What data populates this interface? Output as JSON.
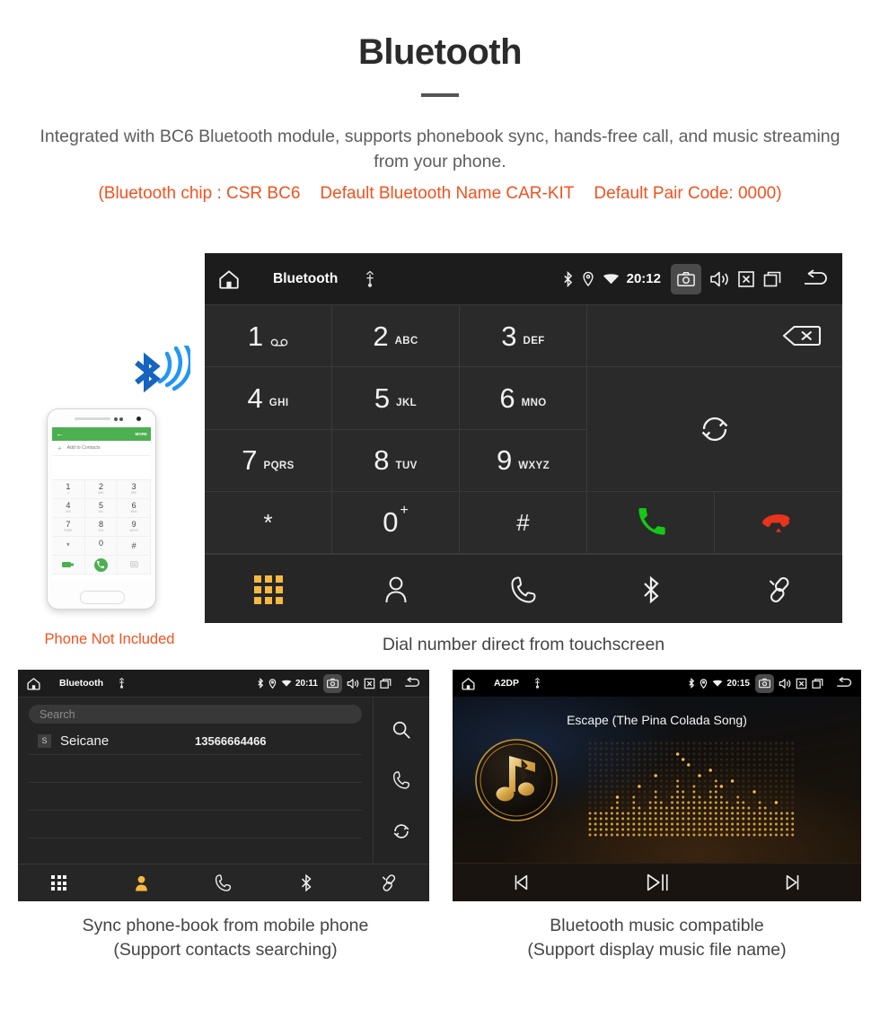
{
  "header": {
    "title": "Bluetooth",
    "description": "Integrated with BC6 Bluetooth module, supports phonebook sync, hands-free call, and music streaming from your phone.",
    "specs": [
      "(Bluetooth chip : CSR BC6",
      "Default Bluetooth Name CAR-KIT",
      "Default Pair Code: 0000)"
    ],
    "accent_color": "#f4511e",
    "body_color": "#5d5d5d"
  },
  "dialer": {
    "status_bar": {
      "home_icon": "home-icon",
      "title": "Bluetooth",
      "usb_icon": "usb-icon",
      "bluetooth_icon": "bluetooth-icon",
      "location_icon": "location-pin-icon",
      "wifi_icon": "wifi-icon",
      "clock": "20:12",
      "camera_icon": "camera-icon",
      "volume_icon": "speaker-icon",
      "close_icon": "close-box-icon",
      "recents_icon": "recent-apps-icon",
      "back_icon": "back-arrow-icon"
    },
    "keys": [
      {
        "digit": "1",
        "letters": "",
        "voicemail": true
      },
      {
        "digit": "2",
        "letters": "ABC"
      },
      {
        "digit": "3",
        "letters": "DEF"
      },
      {
        "digit": "4",
        "letters": "GHI"
      },
      {
        "digit": "5",
        "letters": "JKL"
      },
      {
        "digit": "6",
        "letters": "MNO"
      },
      {
        "digit": "7",
        "letters": "PQRS"
      },
      {
        "digit": "8",
        "letters": "TUV"
      },
      {
        "digit": "9",
        "letters": "WXYZ"
      },
      {
        "digit": "*",
        "letters": ""
      },
      {
        "digit": "0",
        "letters": "",
        "plus": "+"
      },
      {
        "digit": "#",
        "letters": ""
      }
    ],
    "backspace_icon": "backspace-icon",
    "sync_icon": "sync-icon",
    "call_icon": "call-icon",
    "call_color": "#17c617",
    "hangup_icon": "hangup-icon",
    "hangup_color": "#e8341c",
    "nav": [
      {
        "name": "keypad",
        "icon": "keypad-grid-icon",
        "active": true
      },
      {
        "name": "contacts",
        "icon": "person-icon",
        "active": false
      },
      {
        "name": "call-log",
        "icon": "handset-icon",
        "active": false
      },
      {
        "name": "bluetooth",
        "icon": "bluetooth-icon",
        "active": false
      },
      {
        "name": "pair-link",
        "icon": "link-icon",
        "active": false
      }
    ],
    "active_color": "#f5b942",
    "caption": "Dial number direct from touchscreen"
  },
  "phone_illustration": {
    "bluetooth_signal_icon": "bluetooth-signal-icon",
    "app_more_label": "MORE",
    "add_contacts_label": "Add to Contacts",
    "keys": [
      {
        "digit": "1",
        "letters": "∞"
      },
      {
        "digit": "2",
        "letters": "ABC"
      },
      {
        "digit": "3",
        "letters": "DEF"
      },
      {
        "digit": "4",
        "letters": "GHI"
      },
      {
        "digit": "5",
        "letters": "JKL"
      },
      {
        "digit": "6",
        "letters": "MNO"
      },
      {
        "digit": "7",
        "letters": "PQRS"
      },
      {
        "digit": "8",
        "letters": "TUV"
      },
      {
        "digit": "9",
        "letters": "WXYZ"
      },
      {
        "digit": "*",
        "letters": ""
      },
      {
        "digit": "0",
        "letters": "+"
      },
      {
        "digit": "#",
        "letters": ""
      }
    ],
    "caption": "Phone Not Included",
    "caption_color": "#f4511e"
  },
  "phonebook": {
    "status_bar": {
      "title": "Bluetooth",
      "clock": "20:11"
    },
    "search_placeholder": "Search",
    "contacts": [
      {
        "badge": "S",
        "name": "Seicane",
        "number": "13566664466"
      }
    ],
    "empty_rows": 3,
    "side_tools": [
      {
        "name": "search",
        "icon": "search-icon"
      },
      {
        "name": "call",
        "icon": "handset-icon"
      },
      {
        "name": "sync",
        "icon": "sync-icon"
      }
    ],
    "nav": [
      {
        "name": "keypad",
        "icon": "keypad-grid-icon",
        "active": false
      },
      {
        "name": "contacts",
        "icon": "person-filled-icon",
        "active": true
      },
      {
        "name": "call-log",
        "icon": "handset-icon",
        "active": false
      },
      {
        "name": "bluetooth",
        "icon": "bluetooth-icon",
        "active": false
      },
      {
        "name": "pair-link",
        "icon": "link-icon",
        "active": false
      }
    ],
    "caption_line1": "Sync phone-book from mobile phone",
    "caption_line2": "(Support contacts searching)"
  },
  "music": {
    "status_bar": {
      "title": "A2DP",
      "clock": "20:15"
    },
    "track_title": "Escape (The Pina Colada Song)",
    "album_icon": "music-note-bluetooth-icon",
    "visualizer_icon": "dot-matrix-visualizer",
    "controls": [
      {
        "name": "previous",
        "icon": "previous-track-icon"
      },
      {
        "name": "play-pause",
        "icon": "play-pause-icon"
      },
      {
        "name": "next",
        "icon": "next-track-icon"
      }
    ],
    "accent_color": "#d79a34",
    "caption_line1": "Bluetooth music compatible",
    "caption_line2": "(Support display music file name)"
  }
}
